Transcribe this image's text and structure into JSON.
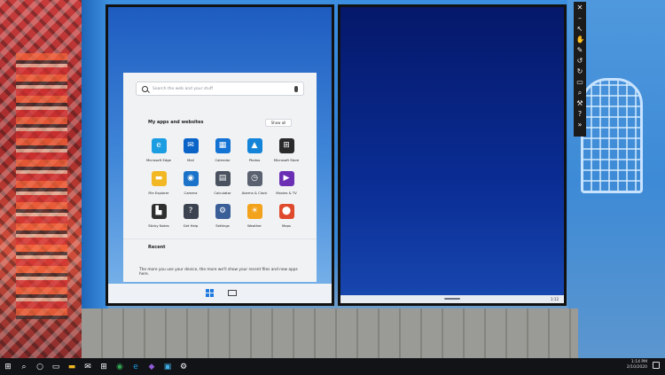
{
  "start_menu": {
    "search_placeholder": "Search the web and your stuff",
    "apps_section_title": "My apps and websites",
    "show_all_label": "Show all",
    "recent_title": "Recent",
    "recent_text": "The more you use your device, the more we'll show your recent files and new apps here.",
    "apps": [
      {
        "label": "Microsoft Edge",
        "icon": "edge-icon",
        "color": "#1b9de2",
        "glyph": "e"
      },
      {
        "label": "Mail",
        "icon": "mail-icon",
        "color": "#0a64c8",
        "glyph": "✉"
      },
      {
        "label": "Calendar",
        "icon": "calendar-icon",
        "color": "#1273d4",
        "glyph": "▦"
      },
      {
        "label": "Photos",
        "icon": "photos-icon",
        "color": "#1484d8",
        "glyph": "▲"
      },
      {
        "label": "Microsoft Store",
        "icon": "store-icon",
        "color": "#2a2a2a",
        "glyph": "⊞"
      },
      {
        "label": "File Explorer",
        "icon": "folder-icon",
        "color": "#f2b824",
        "glyph": "▬"
      },
      {
        "label": "Camera",
        "icon": "camera-icon",
        "color": "#1a72c9",
        "glyph": "◉"
      },
      {
        "label": "Calculator",
        "icon": "calculator-icon",
        "color": "#4a5260",
        "glyph": "▤"
      },
      {
        "label": "Alarms & Clock",
        "icon": "clock-icon",
        "color": "#5a6270",
        "glyph": "◷"
      },
      {
        "label": "Movies & TV",
        "icon": "movies-icon",
        "color": "#6b2fb4",
        "glyph": "▶"
      },
      {
        "label": "Sticky Notes",
        "icon": "sticky-notes-icon",
        "color": "#2f2f2f",
        "glyph": "▙"
      },
      {
        "label": "Get Help",
        "icon": "help-icon",
        "color": "#3c4350",
        "glyph": "?"
      },
      {
        "label": "Settings",
        "icon": "gear-icon",
        "color": "#3a5f98",
        "glyph": "⚙"
      },
      {
        "label": "Weather",
        "icon": "weather-icon",
        "color": "#f3a21b",
        "glyph": "☀"
      },
      {
        "label": "Maps",
        "icon": "maps-icon",
        "color": "#e04a2c",
        "glyph": "⬤"
      }
    ]
  },
  "right_screen": {
    "time": "1:12"
  },
  "toolbar": {
    "buttons": [
      {
        "icon": "close-icon",
        "glyph": "✕"
      },
      {
        "icon": "minimize-icon",
        "glyph": "–"
      },
      {
        "icon": "pointer-icon",
        "glyph": "↖"
      },
      {
        "icon": "hand-icon",
        "glyph": "✋"
      },
      {
        "icon": "pen-icon",
        "glyph": "✎"
      },
      {
        "icon": "rotate-left-icon",
        "glyph": "↺"
      },
      {
        "icon": "rotate-right-icon",
        "glyph": "↻"
      },
      {
        "icon": "fit-screen-icon",
        "glyph": "▭"
      },
      {
        "icon": "zoom-icon",
        "glyph": "⌕"
      },
      {
        "icon": "tools-icon",
        "glyph": "⚒"
      },
      {
        "icon": "help-icon",
        "glyph": "?"
      },
      {
        "icon": "more-icon",
        "glyph": "»"
      }
    ]
  },
  "taskbar": {
    "clock_time": "1:14 PM",
    "clock_date": "2/10/2020",
    "items": [
      {
        "icon": "windows-start-icon",
        "glyph": "⊞",
        "color": "#ffffff"
      },
      {
        "icon": "search-icon",
        "glyph": "⌕",
        "color": "#ffffff"
      },
      {
        "icon": "cortana-icon",
        "glyph": "○",
        "color": "#ffffff"
      },
      {
        "icon": "task-view-icon",
        "glyph": "▭",
        "color": "#ffffff"
      },
      {
        "icon": "file-explorer-icon",
        "glyph": "▬",
        "color": "#f2b824"
      },
      {
        "icon": "mail-icon",
        "glyph": "✉",
        "color": "#ffffff"
      },
      {
        "icon": "store-icon",
        "glyph": "⊞",
        "color": "#ffffff"
      },
      {
        "icon": "chrome-icon",
        "glyph": "◉",
        "color": "#34a853"
      },
      {
        "icon": "edge-icon",
        "glyph": "e",
        "color": "#1b9de2"
      },
      {
        "icon": "visual-studio-icon",
        "glyph": "◆",
        "color": "#8f5bd6"
      },
      {
        "icon": "emulator-icon",
        "glyph": "▣",
        "color": "#3fb0e8"
      },
      {
        "icon": "settings-icon",
        "glyph": "⚙",
        "color": "#ffffff"
      }
    ]
  }
}
